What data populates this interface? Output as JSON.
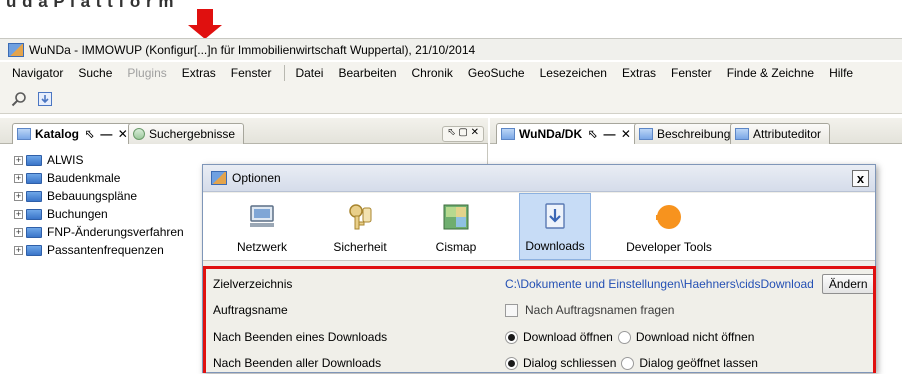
{
  "crop_fragment": "u d a  P l a t t f o r m",
  "window": {
    "title": "WuNDa - IMMOWUP (Konfigur[...]n für Immobilienwirtschaft Wuppertal), 21/10/2014"
  },
  "menubar": {
    "items": [
      "Navigator",
      "Suche",
      "Plugins",
      "Extras",
      "Fenster",
      "Datei",
      "Bearbeiten",
      "Chronik",
      "GeoSuche",
      "Lesezeichen",
      "Extras",
      "Fenster",
      "Finde & Zeichne",
      "Hilfe"
    ]
  },
  "left_panel": {
    "tabs": [
      {
        "label": "Katalog",
        "controls": "⬁ — ✕"
      },
      {
        "label": "Suchergebnisse"
      }
    ],
    "panel_controls": "⬁ ▢ ✕",
    "tree": [
      "ALWIS",
      "Baudenkmale",
      "Bebauungspläne",
      "Buchungen",
      "FNP-Änderungsverfahren",
      "Passantenfrequenzen"
    ]
  },
  "right_panel": {
    "tabs": [
      {
        "label": "WuNDa/DK",
        "controls": "⬁ — ✕"
      },
      {
        "label": "Beschreibung"
      },
      {
        "label": "Attributeditor"
      }
    ]
  },
  "dialog": {
    "title": "Optionen",
    "close": "x",
    "categories": [
      {
        "label": "Netzwerk",
        "icon": "network-icon"
      },
      {
        "label": "Sicherheit",
        "icon": "keys-icon"
      },
      {
        "label": "Cismap",
        "icon": "map-icon"
      },
      {
        "label": "Downloads",
        "icon": "download-icon",
        "selected": true
      },
      {
        "label": "Developer Tools",
        "icon": "developer-tools-icon"
      }
    ],
    "settings": {
      "target_dir_label": "Zielverzeichnis",
      "target_dir_value": "C:\\Dokumente und Einstellungen\\Haehners\\cidsDownload",
      "change_button": "Ändern",
      "job_name_label": "Auftragsname",
      "job_name_checkbox": "Nach Auftragsnamen fragen",
      "after_one_label": "Nach Beenden eines Downloads",
      "after_one_option_a": "Download öffnen",
      "after_one_option_b": "Download nicht öffnen",
      "after_all_label": "Nach Beenden aller Downloads",
      "after_all_option_a": "Dialog schliessen",
      "after_all_option_b": "Dialog geöffnet lassen"
    }
  },
  "colors": {
    "annotation_red": "#e0100f",
    "selection_blue": "#c7dcf6",
    "link_blue": "#2450b4"
  }
}
